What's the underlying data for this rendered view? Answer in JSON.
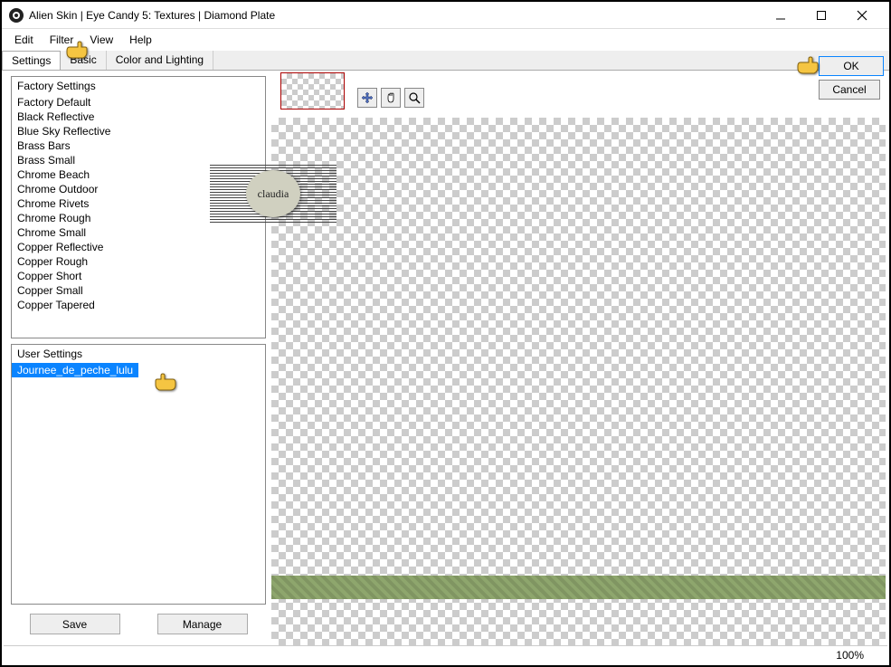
{
  "window": {
    "title": "Alien Skin | Eye Candy 5: Textures | Diamond Plate"
  },
  "menu": {
    "edit": "Edit",
    "filter": "Filter",
    "view": "View",
    "help": "Help"
  },
  "tabs": {
    "settings": "Settings",
    "basic": "Basic",
    "color_lighting": "Color and Lighting"
  },
  "factory": {
    "header": "Factory Settings",
    "items": [
      "Factory Default",
      "Black Reflective",
      "Blue Sky Reflective",
      "Brass Bars",
      "Brass Small",
      "Chrome Beach",
      "Chrome Outdoor",
      "Chrome Rivets",
      "Chrome Rough",
      "Chrome Small",
      "Copper Reflective",
      "Copper Rough",
      "Copper Short",
      "Copper Small",
      "Copper Tapered"
    ]
  },
  "user": {
    "header": "User Settings",
    "selected": "Journee_de_peche_lulu"
  },
  "buttons": {
    "save": "Save",
    "manage": "Manage",
    "ok": "OK",
    "cancel": "Cancel"
  },
  "status": {
    "zoom": "100%"
  },
  "watermark": {
    "text": "claudia"
  }
}
